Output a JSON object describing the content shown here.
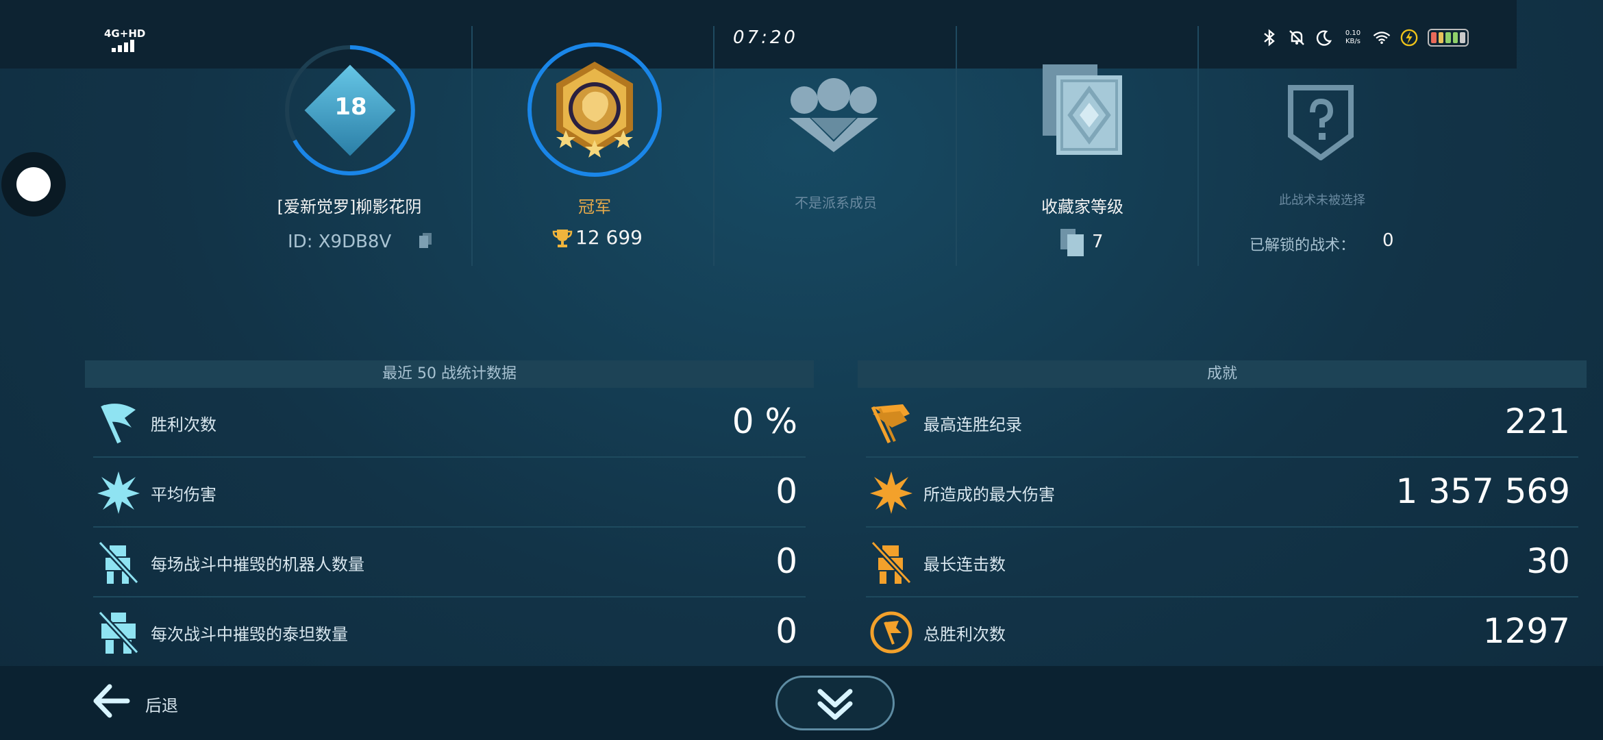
{
  "status_bar": {
    "network": "4G+HD",
    "clock": "07:20",
    "net_speed_value": "0.10",
    "net_speed_unit": "KB/s"
  },
  "profile": {
    "level": "18",
    "player_name": "[爱新觉罗]柳影花阴",
    "player_id": "ID: X9DB8V",
    "rank_title": "冠军",
    "trophies": "12 699",
    "squad_status": "不是派系成员",
    "collection_title": "收藏家等级",
    "collection_count": "7",
    "tech_status": "此战术未被选择",
    "tech_unlocked_label": "已解锁的战术：",
    "tech_unlocked_count": "0"
  },
  "stats_recent": {
    "title": "最近 50 战统计数据",
    "rows": [
      {
        "icon": "flag-icon",
        "label": "胜利次数",
        "value": "0 %"
      },
      {
        "icon": "explosion-icon",
        "label": "平均伤害",
        "value": "0"
      },
      {
        "icon": "robot-destroyed-icon",
        "label": "每场战斗中摧毁的机器人数量",
        "value": "0"
      },
      {
        "icon": "titan-destroyed-icon",
        "label": "每次战斗中摧毁的泰坦数量",
        "value": "0"
      }
    ]
  },
  "achievements": {
    "title": "成就",
    "rows": [
      {
        "icon": "flags-icon",
        "label": "最高连胜纪录",
        "value": "221"
      },
      {
        "icon": "explosion-icon",
        "label": "所造成的最大伤害",
        "value": "1 357 569"
      },
      {
        "icon": "robot-destroyed-icon",
        "label": "最长连击数",
        "value": "30"
      },
      {
        "icon": "flag-circle-icon",
        "label": "总胜利次数",
        "value": "1297"
      }
    ]
  },
  "footer": {
    "back_label": "后退"
  },
  "colors": {
    "accent_blue": "#1a86e8",
    "gold": "#e5a94a",
    "cyan_icon": "#8fe3f2",
    "orange_icon": "#f3a12b"
  }
}
